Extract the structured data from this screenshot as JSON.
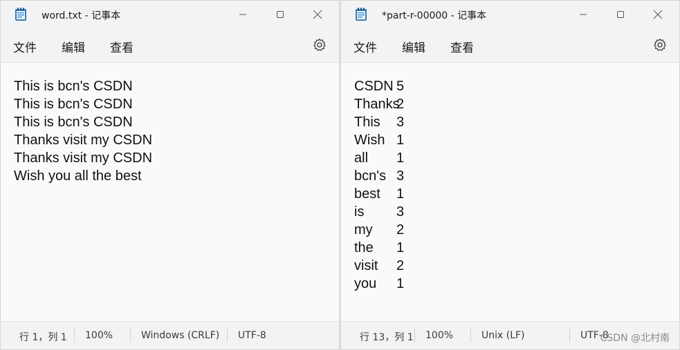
{
  "left_window": {
    "title": "word.txt - 记事本",
    "menu": [
      "文件",
      "编辑",
      "查看"
    ],
    "lines": [
      "This is bcn's CSDN",
      "This is bcn's CSDN",
      "This is bcn's CSDN",
      "Thanks visit my CSDN",
      "Thanks visit my CSDN",
      "Wish you all the best"
    ],
    "status": {
      "position": "行 1，列 1",
      "zoom": "100%",
      "line_ending": "Windows (CRLF)",
      "encoding": "UTF-8"
    }
  },
  "right_window": {
    "title": "*part-r-00000 - 记事本",
    "menu": [
      "文件",
      "编辑",
      "查看"
    ],
    "lines": [
      [
        "CSDN",
        "5"
      ],
      [
        "Thanks",
        "2"
      ],
      [
        "This",
        "3"
      ],
      [
        "Wish",
        "1"
      ],
      [
        "all",
        "1"
      ],
      [
        "bcn's",
        "3"
      ],
      [
        "best",
        "1"
      ],
      [
        "is",
        "3"
      ],
      [
        "my",
        "2"
      ],
      [
        "the",
        "1"
      ],
      [
        "visit",
        "2"
      ],
      [
        "you",
        "1"
      ]
    ],
    "status": {
      "position": "行 13，列 1",
      "zoom": "100%",
      "line_ending": "Unix (LF)",
      "encoding": "UTF-8"
    }
  },
  "watermark": "CSDN @北村南",
  "colors": {
    "accent_icon": "#2b7cd3",
    "background": "#f9f9f9",
    "chrome": "#f3f3f3"
  }
}
